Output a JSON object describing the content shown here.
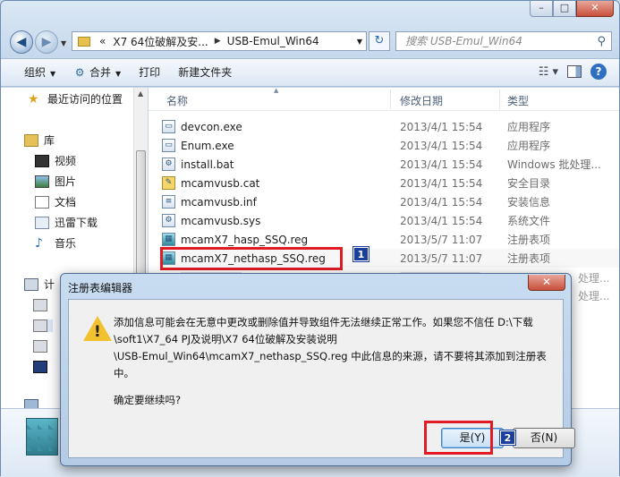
{
  "window": {
    "caption_min": "–",
    "caption_max": "□",
    "caption_close": "✕"
  },
  "address": {
    "back": "◀",
    "forward": "▶",
    "overflow": "«",
    "crumbs": [
      "X7 64位破解及安...",
      "USB-Emul_Win64"
    ],
    "separator": "▶",
    "search_placeholder": "搜索 USB-Emul_Win64"
  },
  "toolbar": {
    "organize": "组织",
    "include": "合并",
    "print": "打印",
    "new_folder": "新建文件夹"
  },
  "navpane": {
    "items": [
      "最近访问的位置",
      "库",
      "视频",
      "图片",
      "文档",
      "迅雷下载",
      "音乐",
      "计"
    ]
  },
  "filelist": {
    "headers": {
      "name": "名称",
      "date": "修改日期",
      "type": "类型"
    },
    "rows": [
      {
        "name": "devcon.exe",
        "date": "2013/4/1 15:54",
        "type": "应用程序",
        "icon": "exe-icon"
      },
      {
        "name": "Enum.exe",
        "date": "2013/4/1 15:54",
        "type": "应用程序",
        "icon": "exe-icon"
      },
      {
        "name": "install.bat",
        "date": "2013/4/1 15:54",
        "type": "Windows 批处理...",
        "icon": "bat-icon"
      },
      {
        "name": "mcamvusb.cat",
        "date": "2013/4/1 15:54",
        "type": "安全目录",
        "icon": "cat-icon"
      },
      {
        "name": "mcamvusb.inf",
        "date": "2013/4/1 15:54",
        "type": "安装信息",
        "icon": "inf-icon"
      },
      {
        "name": "mcamvusb.sys",
        "date": "2013/4/1 15:54",
        "type": "系统文件",
        "icon": "sys-icon"
      },
      {
        "name": "mcamX7_hasp_SSQ.reg",
        "date": "2013/5/7 11:07",
        "type": "注册表项",
        "icon": "reg-icon"
      },
      {
        "name": "mcamX7_nethasp_SSQ.reg",
        "date": "2013/5/7 11:07",
        "type": "注册表项",
        "icon": "reg-icon"
      }
    ],
    "ghost_types": [
      "处理...",
      "处理..."
    ]
  },
  "annotations": {
    "badge1": "1",
    "badge2": "2"
  },
  "dialog": {
    "title": "注册表编辑器",
    "message_lines": [
      "添加信息可能会在无意中更改或删除值并导致组件无法继续正常工作。如果您不信任 D:\\下载",
      "\\soft1\\X7_64 PJ及说明\\X7 64位破解及安装说明",
      "\\USB-Emul_Win64\\mcamX7_nethasp_SSQ.reg 中此信息的来源，请不要将其添加到注册表",
      "中。"
    ],
    "confirm": "确定要继续吗?",
    "yes": "是(Y)",
    "no": "否(N)"
  },
  "colors": {
    "highlight_box": "#e01b24",
    "badge": "#1b3f9a"
  }
}
